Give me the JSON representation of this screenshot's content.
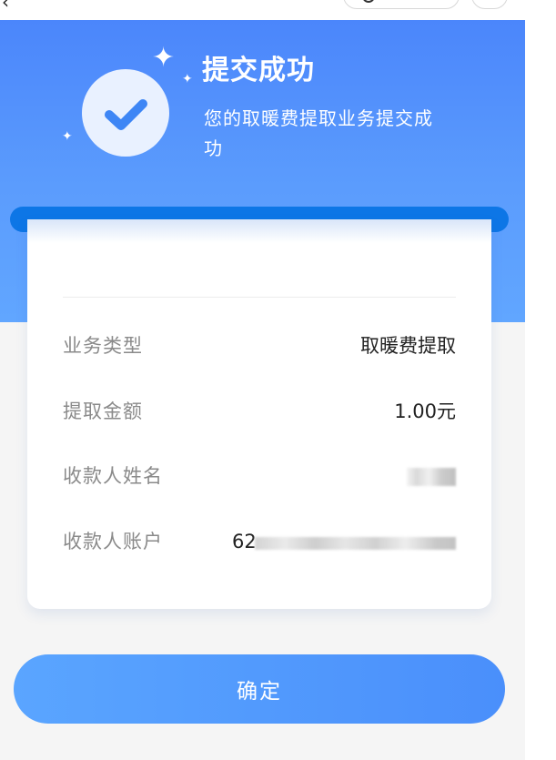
{
  "nav": {
    "back_icon": "chevron-left-icon",
    "title": "",
    "menu_icon": "more-dots-icon",
    "close_icon": "close-circle-icon"
  },
  "result": {
    "title": "提交成功",
    "subtitle": "您的取暖费提取业务提交成功",
    "status_icon": "check-circle-icon",
    "accent_color": "#4a8ffb"
  },
  "details": [
    {
      "label": "业务类型",
      "value": "取暖费提取"
    },
    {
      "label": "提取金额",
      "value": "1.00元"
    },
    {
      "label": "收款人姓名",
      "value": ""
    },
    {
      "label": "收款人账户",
      "value": "62"
    }
  ],
  "actions": {
    "confirm_label": "确定"
  }
}
